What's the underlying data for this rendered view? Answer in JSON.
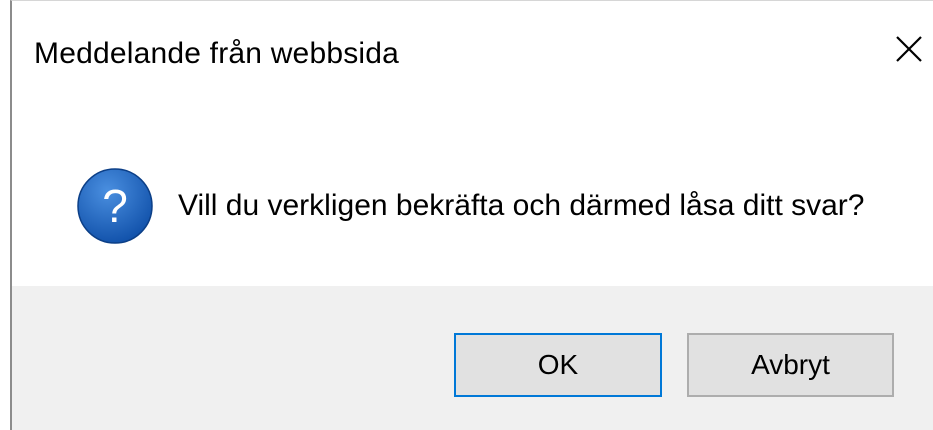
{
  "dialog": {
    "title": "Meddelande från webbsida",
    "message": "Vill du verkligen bekräfta och därmed låsa ditt svar?",
    "icon": "question-icon",
    "buttons": {
      "ok_label": "OK",
      "cancel_label": "Avbryt"
    },
    "colors": {
      "icon_blue": "#1a5fb4",
      "default_button_border": "#0078d7",
      "footer_bg": "#f0f0f0"
    }
  }
}
